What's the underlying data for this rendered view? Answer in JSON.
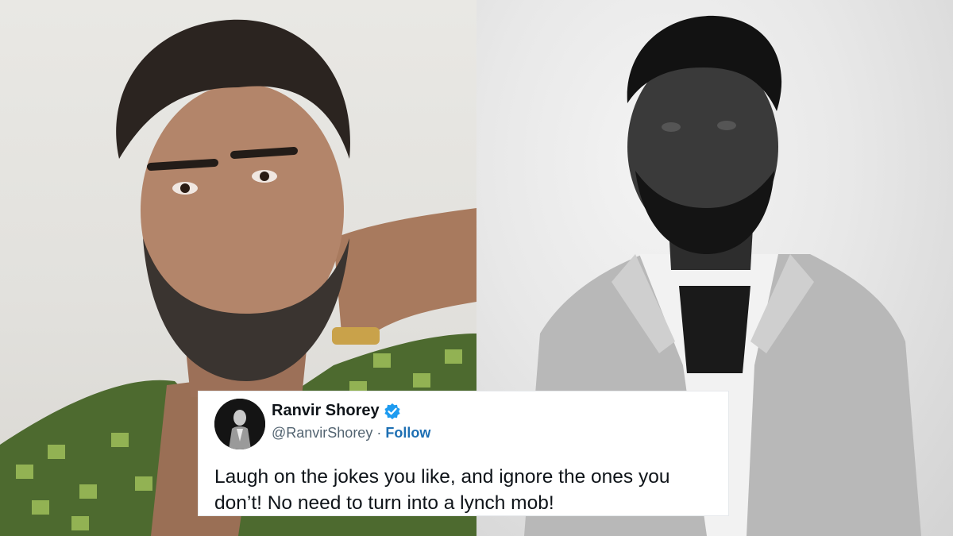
{
  "images": {
    "left_photo": {
      "description_icon": "person-photo-left"
    },
    "right_photo": {
      "description_icon": "person-photo-right"
    }
  },
  "tweet": {
    "name": "Ranvir Shorey",
    "handle": "@RanvirShorey",
    "separator": "·",
    "follow_label": "Follow",
    "text": "Laugh on the jokes you like, and ignore the ones you don’t! No need to turn into a lynch mob!",
    "verified_color": "#1d9bf0",
    "follow_color": "#1d6fb3"
  }
}
